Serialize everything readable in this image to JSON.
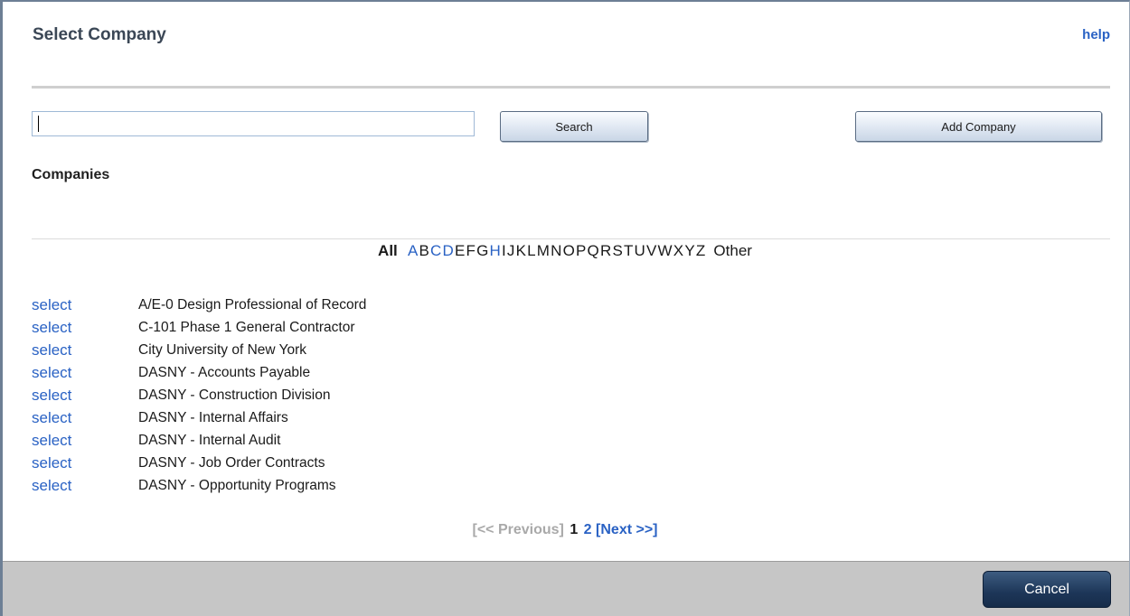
{
  "header": {
    "title": "Select Company",
    "help_label": "help"
  },
  "search": {
    "value": "",
    "placeholder": "",
    "button_label": "Search"
  },
  "actions": {
    "add_company_label": "Add Company",
    "cancel_label": "Cancel"
  },
  "section": {
    "label": "Companies"
  },
  "alpha_filter": {
    "all_label": "All",
    "letters": [
      {
        "letter": "A",
        "active": true
      },
      {
        "letter": "B",
        "active": false
      },
      {
        "letter": "C",
        "active": true
      },
      {
        "letter": "D",
        "active": true
      },
      {
        "letter": "E",
        "active": false
      },
      {
        "letter": "F",
        "active": false
      },
      {
        "letter": "G",
        "active": false
      },
      {
        "letter": "H",
        "active": true
      },
      {
        "letter": "I",
        "active": false
      },
      {
        "letter": "J",
        "active": false
      },
      {
        "letter": "K",
        "active": false
      },
      {
        "letter": "L",
        "active": false
      },
      {
        "letter": "M",
        "active": false
      },
      {
        "letter": "N",
        "active": false
      },
      {
        "letter": "O",
        "active": false
      },
      {
        "letter": "P",
        "active": false
      },
      {
        "letter": "Q",
        "active": false
      },
      {
        "letter": "R",
        "active": false
      },
      {
        "letter": "S",
        "active": false
      },
      {
        "letter": "T",
        "active": false
      },
      {
        "letter": "U",
        "active": false
      },
      {
        "letter": "V",
        "active": false
      },
      {
        "letter": "W",
        "active": false
      },
      {
        "letter": "X",
        "active": false
      },
      {
        "letter": "Y",
        "active": false
      },
      {
        "letter": "Z",
        "active": false
      }
    ],
    "other_label": "Other"
  },
  "companies": [
    {
      "action": "select",
      "name": "A/E-0 Design Professional of Record"
    },
    {
      "action": "select",
      "name": "C-101 Phase 1 General Contractor"
    },
    {
      "action": "select",
      "name": "City University of New York"
    },
    {
      "action": "select",
      "name": "DASNY - Accounts Payable"
    },
    {
      "action": "select",
      "name": "DASNY - Construction Division"
    },
    {
      "action": "select",
      "name": "DASNY - Internal Affairs"
    },
    {
      "action": "select",
      "name": "DASNY - Internal Audit"
    },
    {
      "action": "select",
      "name": "DASNY - Job Order Contracts"
    },
    {
      "action": "select",
      "name": "DASNY - Opportunity Programs"
    }
  ],
  "pager": {
    "previous_label": "[<< Previous]",
    "pages": [
      {
        "label": "1",
        "current": true
      },
      {
        "label": "2",
        "current": false
      }
    ],
    "next_label": "[Next >>]"
  },
  "colors": {
    "link": "#2a62c4",
    "footer": "#c6c6c6",
    "cancel_button": "#1d3658"
  }
}
